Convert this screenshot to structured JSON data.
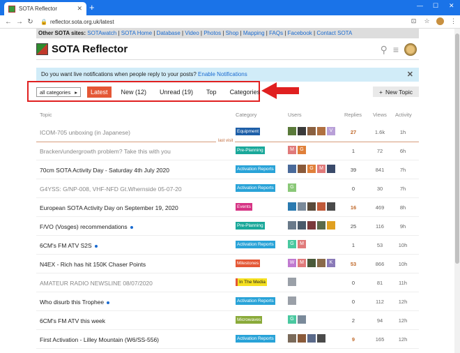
{
  "browser": {
    "tab_title": "SOTA Reflector",
    "url": "reflector.sota.org.uk/latest",
    "new_tab": "+",
    "close": "✕"
  },
  "sites_bar": {
    "label": "Other SOTA sites:",
    "links": [
      "SOTAwatch",
      "SOTA Home",
      "Database",
      "Video",
      "Photos",
      "Shop",
      "Mapping",
      "FAQs",
      "Facebook",
      "Contact SOTA"
    ]
  },
  "header": {
    "title": "SOTA Reflector"
  },
  "notification": {
    "text": "Do you want live notifications when people reply to your posts?",
    "link": "Enable Notifications"
  },
  "nav": {
    "all_categories": "all categories",
    "latest": "Latest",
    "new": "New (12)",
    "unread": "Unread (19)",
    "top": "Top",
    "categories": "Categories",
    "new_topic": "New Topic"
  },
  "columns": {
    "topic": "Topic",
    "category": "Category",
    "users": "Users",
    "replies": "Replies",
    "views": "Views",
    "activity": "Activity"
  },
  "last_visit": "last visit",
  "colors": {
    "accent": "#e45735",
    "link": "#1a6bd0",
    "notice_bg": "#d1ecf8"
  },
  "topics": [
    {
      "title": "ICOM-705 unboxing (in Japanese)",
      "visited": true,
      "dot": false,
      "category": "Equipment",
      "cat_color": "#1e5fa8",
      "users": [
        {
          "c": "#5a7a3a",
          "t": ""
        },
        {
          "c": "#3a3a3a",
          "t": ""
        },
        {
          "c": "#8a6040",
          "t": ""
        },
        {
          "c": "#b07040",
          "t": ""
        },
        {
          "c": "#b9a0d8",
          "t": "V"
        }
      ],
      "replies": "27",
      "rep_hot": true,
      "views": "1.6k",
      "activity": "1h"
    },
    {
      "title": "Bracken/undergrowth problem? Take this with you",
      "visited": true,
      "dot": false,
      "category": "Pre-Planning",
      "cat_color": "#1aa89a",
      "users": [
        {
          "c": "#e07a7a",
          "t": "M"
        },
        {
          "c": "#e0803a",
          "t": "G"
        }
      ],
      "replies": "1",
      "rep_hot": false,
      "views": "72",
      "activity": "6h"
    },
    {
      "title": "70cm SOTA Activity Day - Saturday 4th July 2020",
      "visited": false,
      "dot": false,
      "category": "Activation Reports",
      "cat_color": "#29a3d8",
      "users": [
        {
          "c": "#4a6a9a",
          "t": ""
        },
        {
          "c": "#8a5a3a",
          "t": ""
        },
        {
          "c": "#e0803a",
          "t": "G"
        },
        {
          "c": "#e07a7a",
          "t": "M"
        },
        {
          "c": "#3a4a6a",
          "t": ""
        }
      ],
      "replies": "39",
      "rep_hot": false,
      "views": "841",
      "activity": "7h"
    },
    {
      "title": "G4YSS: G/NP-008, VHF-NFD Gt.Whernside 05-07-20",
      "visited": true,
      "dot": false,
      "category": "Activation Reports",
      "cat_color": "#29a3d8",
      "users": [
        {
          "c": "#8ac878",
          "t": "G"
        }
      ],
      "replies": "0",
      "rep_hot": false,
      "views": "30",
      "activity": "7h"
    },
    {
      "title": "European SOTA Activity Day on September 19, 2020",
      "visited": false,
      "dot": false,
      "category": "Events",
      "cat_color": "#d63384",
      "users": [
        {
          "c": "#2a7ab0",
          "t": ""
        },
        {
          "c": "#7a8a9a",
          "t": ""
        },
        {
          "c": "#5a4a3a",
          "t": ""
        },
        {
          "c": "#c05a3a",
          "t": ""
        },
        {
          "c": "#4a4a4a",
          "t": ""
        }
      ],
      "replies": "16",
      "rep_hot": true,
      "views": "469",
      "activity": "8h"
    },
    {
      "title": "F/VO (Vosges) recommendations",
      "visited": false,
      "dot": true,
      "category": "Pre-Planning",
      "cat_color": "#1aa89a",
      "users": [
        {
          "c": "#6a7a8a",
          "t": ""
        },
        {
          "c": "#4a5a6a",
          "t": ""
        },
        {
          "c": "#7a3a3a",
          "t": ""
        },
        {
          "c": "#5a6a4a",
          "t": ""
        },
        {
          "c": "#e0a020",
          "t": ""
        }
      ],
      "replies": "25",
      "rep_hot": false,
      "views": "116",
      "activity": "9h"
    },
    {
      "title": "6CM's FM ATV S2S",
      "visited": false,
      "dot": true,
      "category": "Activation Reports",
      "cat_color": "#29a3d8",
      "users": [
        {
          "c": "#4ac8a0",
          "t": "G"
        },
        {
          "c": "#e07a7a",
          "t": "M"
        }
      ],
      "replies": "1",
      "rep_hot": false,
      "views": "53",
      "activity": "10h"
    },
    {
      "title": "N4EX - Rich has hit 150K Chaser Points",
      "visited": false,
      "dot": false,
      "category": "Milestones",
      "cat_color": "#e45735",
      "users": [
        {
          "c": "#c07ad0",
          "t": "W"
        },
        {
          "c": "#e07a7a",
          "t": "M"
        },
        {
          "c": "#4a5a3a",
          "t": ""
        },
        {
          "c": "#8a6a4a",
          "t": ""
        },
        {
          "c": "#8a7ab8",
          "t": "K"
        }
      ],
      "replies": "53",
      "rep_hot": true,
      "views": "866",
      "activity": "10h"
    },
    {
      "title": "AMATEUR RADIO NEWSLINE 08/07/2020",
      "visited": true,
      "dot": false,
      "category": "In The Media",
      "cat_color": "#f5e020",
      "users": [
        {
          "c": "#9aa0a8",
          "t": ""
        }
      ],
      "replies": "0",
      "rep_hot": false,
      "views": "81",
      "activity": "11h"
    },
    {
      "title": "Who disurb this Trophee",
      "visited": false,
      "dot": true,
      "category": "Activation Reports",
      "cat_color": "#29a3d8",
      "users": [
        {
          "c": "#9aa0a8",
          "t": ""
        }
      ],
      "replies": "0",
      "rep_hot": false,
      "views": "112",
      "activity": "12h"
    },
    {
      "title": "6CM's FM ATV this week",
      "visited": false,
      "dot": false,
      "category": "Microwaves",
      "cat_color": "#8aaa3a",
      "users": [
        {
          "c": "#4ac8a0",
          "t": "G"
        },
        {
          "c": "#7a8a9a",
          "t": ""
        }
      ],
      "replies": "2",
      "rep_hot": false,
      "views": "94",
      "activity": "12h"
    },
    {
      "title": "First Activation - Lilley Mountain (W6/SS-556)",
      "visited": false,
      "dot": false,
      "category": "Activation Reports",
      "cat_color": "#29a3d8",
      "users": [
        {
          "c": "#7a6a5a",
          "t": ""
        },
        {
          "c": "#8a5a3a",
          "t": ""
        },
        {
          "c": "#5a6a8a",
          "t": ""
        },
        {
          "c": "#4a4a4a",
          "t": ""
        }
      ],
      "replies": "9",
      "rep_hot": true,
      "views": "165",
      "activity": "12h"
    }
  ]
}
